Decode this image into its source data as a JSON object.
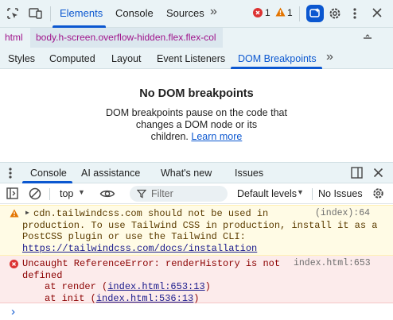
{
  "top_tabs": [
    {
      "label": "Elements",
      "active": true
    },
    {
      "label": "Console",
      "active": false
    },
    {
      "label": "Sources",
      "active": false
    }
  ],
  "counts": {
    "errors": "1",
    "warnings": "1"
  },
  "breadcrumb": {
    "items": [
      "html",
      "body.h-screen.overflow-hidden.flex.flex-col"
    ]
  },
  "sub_tabs": [
    "Styles",
    "Computed",
    "Layout",
    "Event Listeners",
    "DOM Breakpoints"
  ],
  "active_sub_tab": "DOM Breakpoints",
  "empty_state": {
    "title": "No DOM breakpoints",
    "line1": "DOM breakpoints pause on the code that",
    "line2": "changes a DOM node or its",
    "line3": "children.",
    "link": "Learn more"
  },
  "drawer_tabs": [
    "Console",
    "AI assistance",
    "What's new",
    "Issues"
  ],
  "console_toolbar": {
    "context": "top",
    "filter_placeholder": "Filter",
    "levels": "Default levels",
    "issues": "No Issues"
  },
  "messages": [
    {
      "type": "warning",
      "lines": [
        "cdn.tailwindcss.com should not be used in",
        "production. To use Tailwind CSS in production, install it as a",
        "PostCSS plugin or use the Tailwind CLI:"
      ],
      "link": "https://tailwindcss.com/docs/installation",
      "source": "(index):64"
    },
    {
      "type": "error",
      "line1": "Uncaught ReferenceError: renderHistory is not",
      "line2": "defined",
      "stack": [
        {
          "prefix": "at render (",
          "link": "index.html:653:13",
          "suffix": ")"
        },
        {
          "prefix": "at init (",
          "link": "index.html:536:13",
          "suffix": ")"
        }
      ],
      "source": "index.html:653"
    }
  ],
  "colors": {
    "accent": "#0b57d0",
    "toolbar_bg": "#eaf3f6",
    "warning_bg": "#fffbe5",
    "error_bg": "#fcebeb"
  }
}
